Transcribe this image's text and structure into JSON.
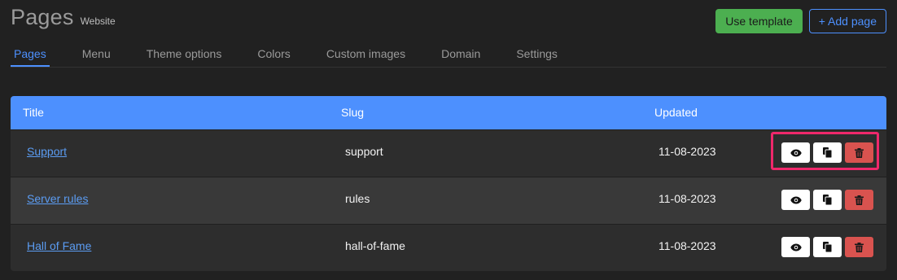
{
  "header": {
    "title": "Pages",
    "subtitle": "Website"
  },
  "actions": {
    "use_template_label": "Use template",
    "add_page_label": "+ Add page"
  },
  "tabs": [
    {
      "label": "Pages",
      "active": true
    },
    {
      "label": "Menu",
      "active": false
    },
    {
      "label": "Theme options",
      "active": false
    },
    {
      "label": "Colors",
      "active": false
    },
    {
      "label": "Custom images",
      "active": false
    },
    {
      "label": "Domain",
      "active": false
    },
    {
      "label": "Settings",
      "active": false
    }
  ],
  "table": {
    "columns": [
      "Title",
      "Slug",
      "Updated"
    ],
    "rows": [
      {
        "title": "Support",
        "slug": "support",
        "updated": "11-08-2023"
      },
      {
        "title": "Server rules",
        "slug": "rules",
        "updated": "11-08-2023"
      },
      {
        "title": "Hall of Fame",
        "slug": "hall-of-fame",
        "updated": "11-08-2023"
      }
    ],
    "row_actions": [
      "eye-icon",
      "copy-icon",
      "trash-icon"
    ]
  },
  "colors": {
    "accent": "#4d90fe",
    "success": "#4caf50",
    "danger": "#d9534f",
    "highlight": "#f0286b",
    "background": "#212121"
  }
}
